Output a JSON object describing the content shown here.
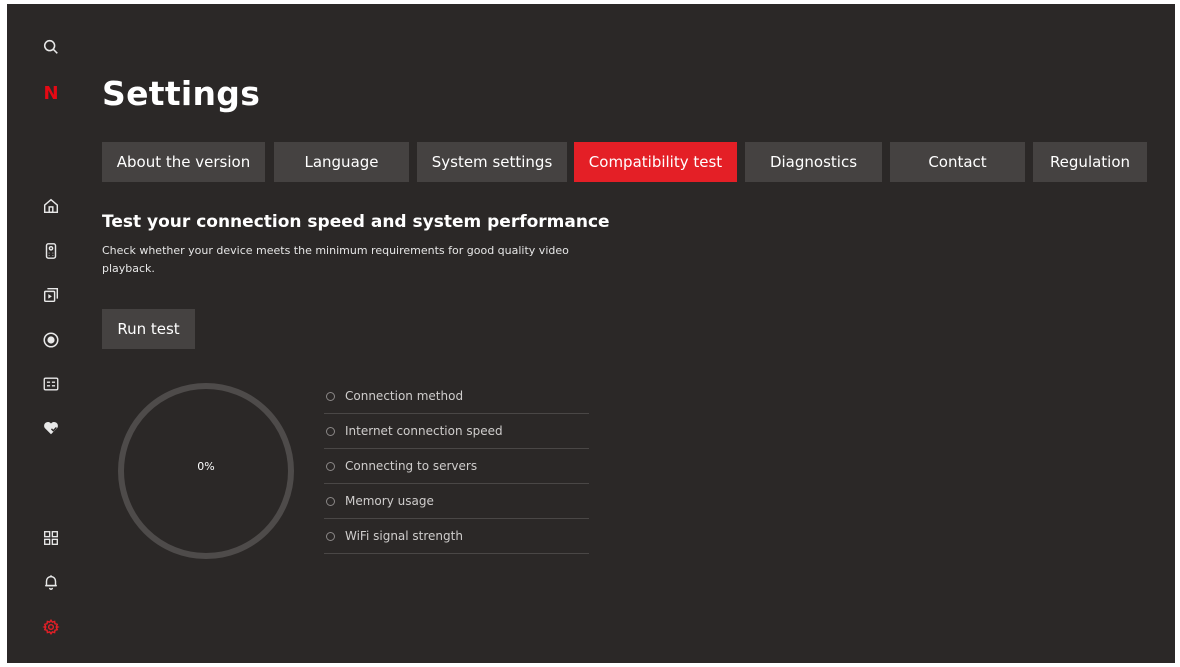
{
  "app": {
    "logo_letter": "N",
    "brand_color": "#e50914"
  },
  "sidebar": {
    "items": [
      {
        "icon": "search-icon"
      },
      {
        "icon": "netflix-logo"
      },
      {
        "icon": "home-icon"
      },
      {
        "icon": "remote-icon"
      },
      {
        "icon": "tv-input-icon"
      },
      {
        "icon": "record-icon"
      },
      {
        "icon": "guide-icon"
      },
      {
        "icon": "favorites-icon"
      },
      {
        "icon": "apps-icon"
      },
      {
        "icon": "bell-icon"
      },
      {
        "icon": "gear-icon",
        "active": true
      }
    ]
  },
  "page": {
    "title": "Settings"
  },
  "tabs": {
    "items": [
      {
        "label": "About the version"
      },
      {
        "label": "Language"
      },
      {
        "label": "System settings"
      },
      {
        "label": "Compatibility test",
        "active": true
      },
      {
        "label": "Diagnostics"
      },
      {
        "label": "Contact"
      },
      {
        "label": "Regulation"
      }
    ],
    "active_color": "#e41f26"
  },
  "test": {
    "heading": "Test your connection speed and system performance",
    "description": "Check whether your device meets the minimum requirements for good quality video playback.",
    "run_label": "Run test",
    "progress_label": "0%",
    "progress": 0,
    "checks": [
      {
        "label": "Connection method"
      },
      {
        "label": "Internet connection speed"
      },
      {
        "label": "Connecting to servers"
      },
      {
        "label": "Memory usage"
      },
      {
        "label": "WiFi signal strength"
      }
    ]
  }
}
